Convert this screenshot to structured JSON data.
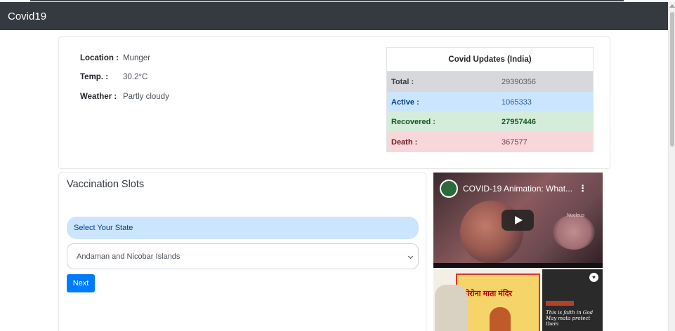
{
  "navbar": {
    "brand": "Covid19"
  },
  "location_info": [
    {
      "label": "Location :",
      "value": "Munger"
    },
    {
      "label": "Temp. :",
      "value": "30.2°C"
    },
    {
      "label": "Weather :",
      "value": "Partly cloudy"
    }
  ],
  "covid_updates": {
    "title": "Covid Updates (India)",
    "rows": [
      {
        "label": "Total :",
        "value": "29390356"
      },
      {
        "label": "Active :",
        "value": "1065333"
      },
      {
        "label": "Recovered :",
        "value": "27957446"
      },
      {
        "label": "Death :",
        "value": "367577"
      }
    ]
  },
  "vaccination": {
    "title": "Vaccination Slots",
    "state_label": "Select Your State",
    "selected_state": "Andaman and Nicobar Islands",
    "next_label": "Next"
  },
  "videos": [
    {
      "title": "COVID-19 Animation: What...",
      "watermark": "Nucleus",
      "menu_icon": "more-vert-icon"
    },
    {
      "caption": "This is faith in God May mata protect them",
      "poster_text": "कोरोना माता मंदिर"
    }
  ],
  "colors": {
    "navbar": "#343a40",
    "primary": "#007bff",
    "total_bg": "#d6d8db",
    "active_bg": "#cce5ff",
    "recovered_bg": "#d4edda",
    "death_bg": "#f8d7da"
  }
}
